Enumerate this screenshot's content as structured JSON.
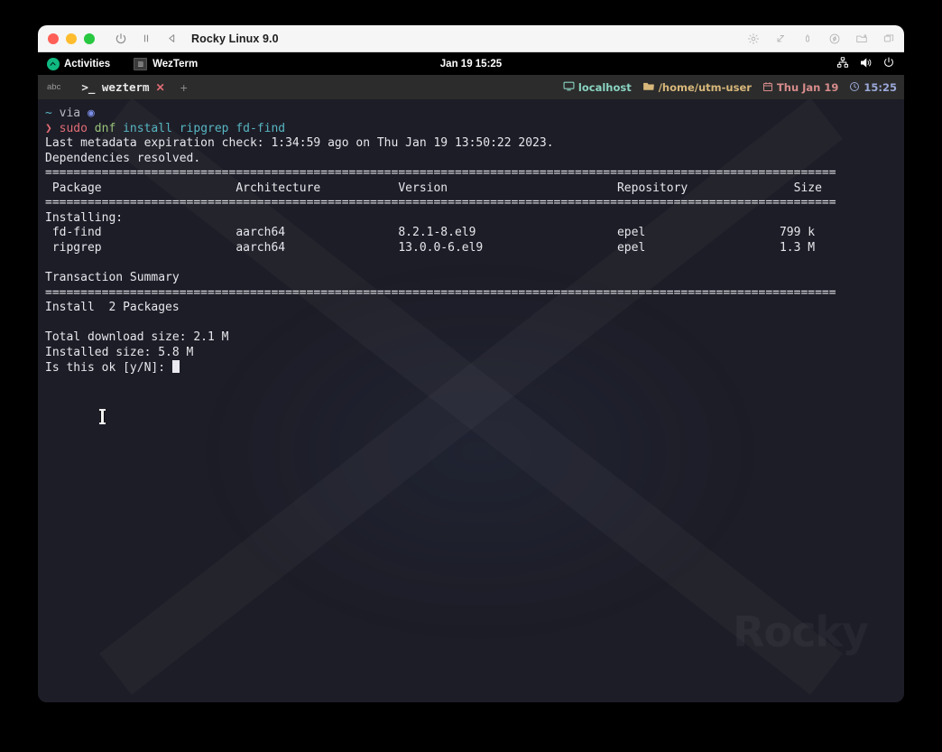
{
  "vm_window": {
    "title": "Rocky Linux 9.0",
    "controls": {
      "close": "close-window",
      "minimize": "minimize-window",
      "maximize": "maximize-window",
      "power": "⏻",
      "pause": "II",
      "back": "◁"
    },
    "toolbar_right": {
      "brightness": "✳",
      "resize": "⤡",
      "usb": "⎘",
      "disk": "◎",
      "folder": "🗁",
      "windows": "❐"
    }
  },
  "gnome": {
    "activities": "Activities",
    "app_name": "WezTerm",
    "app_icon_text": "▥",
    "clock": "Jan 19  15:25",
    "tray": {
      "network": "network-icon",
      "volume": "volume-icon",
      "power": "power-icon"
    }
  },
  "tabbar": {
    "ime_badge": "abc",
    "tab_label": ">_ wezterm",
    "tab_close": "✕",
    "new_tab": "+",
    "status": {
      "host_icon": "🖥",
      "host": "localhost",
      "path_icon": "🗁",
      "path": "/home/utm-user",
      "date_icon": "📅",
      "date": "Thu Jan 19",
      "clock_icon": "🕐",
      "time": "15:25"
    },
    "colors": {
      "host": "#8ad4c1",
      "path": "#d7b77a",
      "date": "#d78b8b",
      "time": "#9aa8d8"
    }
  },
  "terminal": {
    "wallpaper_wordmark": "Rocky",
    "lines": [
      {
        "id": "prompt-dir",
        "segments": [
          {
            "t": "~ ",
            "c": "c-cyan"
          },
          {
            "t": "via ",
            "c": "c-dim"
          },
          {
            "t": "◉",
            "c": "c-blue"
          }
        ]
      },
      {
        "id": "command",
        "segments": [
          {
            "t": "❯ ",
            "c": "c-red"
          },
          {
            "t": "sudo ",
            "c": "c-red"
          },
          {
            "t": "dnf ",
            "c": "c-green"
          },
          {
            "t": "install ripgrep fd-find",
            "c": "c-cyan"
          }
        ]
      },
      {
        "id": "metadata",
        "segments": [
          {
            "t": "Last metadata expiration check: 1:34:59 ago on Thu Jan 19 13:50:22 2023.",
            "c": "c-white"
          }
        ]
      },
      {
        "id": "deps",
        "segments": [
          {
            "t": "Dependencies resolved.",
            "c": "c-white"
          }
        ]
      },
      {
        "id": "rule-1",
        "segments": [
          {
            "t": "================================================================================================================",
            "c": "c-white"
          }
        ]
      },
      {
        "id": "table-header",
        "segments": [
          {
            "t": " Package                   Architecture           Version                        Repository               Size",
            "c": "c-white"
          }
        ]
      },
      {
        "id": "rule-2",
        "segments": [
          {
            "t": "================================================================================================================",
            "c": "c-white"
          }
        ]
      },
      {
        "id": "installing",
        "segments": [
          {
            "t": "Installing:",
            "c": "c-white"
          }
        ]
      },
      {
        "id": "pkg-fd-find",
        "segments": [
          {
            "t": " fd-find                   aarch64                8.2.1-8.el9                    epel                   799 k",
            "c": "c-white"
          }
        ]
      },
      {
        "id": "pkg-ripgrep",
        "segments": [
          {
            "t": " ripgrep                   aarch64                13.0.0-6.el9                   epel                   1.3 M",
            "c": "c-white"
          }
        ]
      },
      {
        "id": "blank-1",
        "segments": [
          {
            "t": " ",
            "c": "c-white"
          }
        ]
      },
      {
        "id": "summary-head",
        "segments": [
          {
            "t": "Transaction Summary",
            "c": "c-white"
          }
        ]
      },
      {
        "id": "rule-3",
        "segments": [
          {
            "t": "================================================================================================================",
            "c": "c-white"
          }
        ]
      },
      {
        "id": "install-count",
        "segments": [
          {
            "t": "Install  2 Packages",
            "c": "c-white"
          }
        ]
      },
      {
        "id": "blank-2",
        "segments": [
          {
            "t": " ",
            "c": "c-white"
          }
        ]
      },
      {
        "id": "dl-size",
        "segments": [
          {
            "t": "Total download size: 2.1 M",
            "c": "c-white"
          }
        ]
      },
      {
        "id": "inst-size",
        "segments": [
          {
            "t": "Installed size: 5.8 M",
            "c": "c-white"
          }
        ]
      },
      {
        "id": "confirm",
        "segments": [
          {
            "t": "Is this ok [y/N]: ",
            "c": "c-white"
          }
        ],
        "cursor": true
      }
    ],
    "table": {
      "columns": [
        "Package",
        "Architecture",
        "Version",
        "Repository",
        "Size"
      ],
      "rows": [
        {
          "package": "fd-find",
          "architecture": "aarch64",
          "version": "8.2.1-8.el9",
          "repository": "epel",
          "size": "799 k"
        },
        {
          "package": "ripgrep",
          "architecture": "aarch64",
          "version": "13.0.0-6.el9",
          "repository": "epel",
          "size": "1.3 M"
        }
      ]
    },
    "summary": {
      "heading": "Transaction Summary",
      "install_action": "Install",
      "install_count": "2 Packages",
      "total_download_size": "2.1 M",
      "installed_size": "5.8 M",
      "prompt": "Is this ok [y/N]:"
    }
  }
}
